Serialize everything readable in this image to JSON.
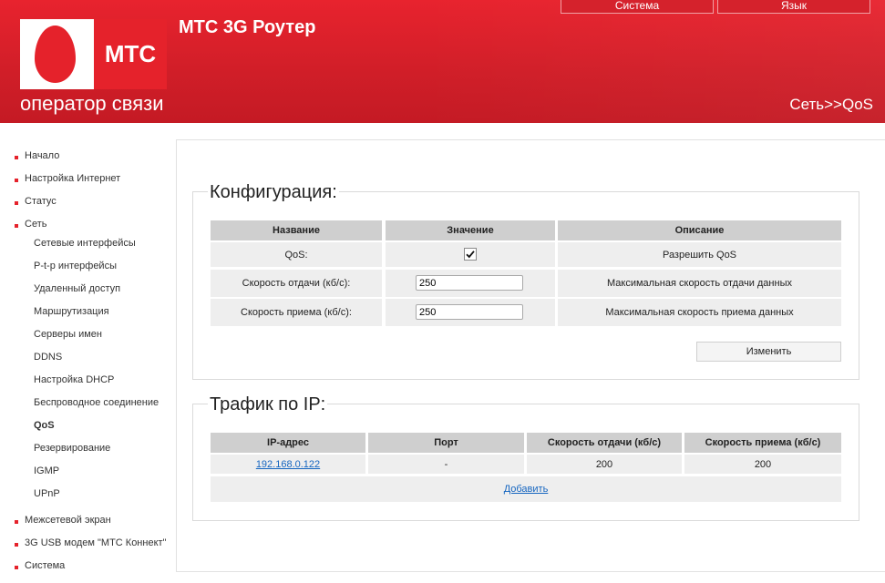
{
  "header": {
    "top_buttons": [
      "Система",
      "Язык"
    ],
    "logo_text": "МТС",
    "logo_subtitle": "оператор связи",
    "app_title": "МТС 3G Роутер",
    "breadcrumb": "Сеть>>QoS"
  },
  "sidebar": {
    "items": [
      {
        "label": "Начало",
        "level": 0
      },
      {
        "label": "Настройка Интернет",
        "level": 0
      },
      {
        "label": "Статус",
        "level": 0
      },
      {
        "label": "Сеть",
        "level": 0
      },
      {
        "label": "Сетевые интерфейсы",
        "level": 1
      },
      {
        "label": "P-t-p интерфейсы",
        "level": 1
      },
      {
        "label": "Удаленный доступ",
        "level": 1
      },
      {
        "label": "Маршрутизация",
        "level": 1
      },
      {
        "label": "Серверы имен",
        "level": 1
      },
      {
        "label": "DDNS",
        "level": 1
      },
      {
        "label": "Настройка DHCP",
        "level": 1
      },
      {
        "label": "Беспроводное соединение",
        "level": 1
      },
      {
        "label": "QoS",
        "level": 1,
        "active": true
      },
      {
        "label": "Резервирование",
        "level": 1
      },
      {
        "label": "IGMP",
        "level": 1
      },
      {
        "label": "UPnP",
        "level": 1
      },
      {
        "label": "Межсетевой экран",
        "level": 0
      },
      {
        "label": "3G USB модем \"МТС Коннект\"",
        "level": 0
      },
      {
        "label": "Система",
        "level": 0
      }
    ]
  },
  "config": {
    "title": "Конфигурация:",
    "headers": [
      "Название",
      "Значение",
      "Описание"
    ],
    "rows": [
      {
        "name": "QoS:",
        "type": "checkbox",
        "checked": true,
        "description": "Разрешить QoS"
      },
      {
        "name": "Скорость отдачи (кб/с):",
        "type": "input",
        "value": "250",
        "description": "Максимальная скорость отдачи данных"
      },
      {
        "name": "Скорость приема (кб/с):",
        "type": "input",
        "value": "250",
        "description": "Максимальная скорость приема данных"
      }
    ],
    "change_button": "Изменить"
  },
  "traffic": {
    "title": "Трафик по IP:",
    "headers": [
      "IP-адрес",
      "Порт",
      "Скорость отдачи (кб/с)",
      "Скорость приема (кб/с)"
    ],
    "rows": [
      {
        "ip": "192.168.0.122",
        "port": "-",
        "upload": "200",
        "download": "200"
      }
    ],
    "add_link": "Добавить"
  },
  "colors": {
    "brand_red": "#e5222b",
    "header_cell": "#cfcfcf",
    "data_cell": "#eeeeee",
    "link": "#1565c0"
  }
}
